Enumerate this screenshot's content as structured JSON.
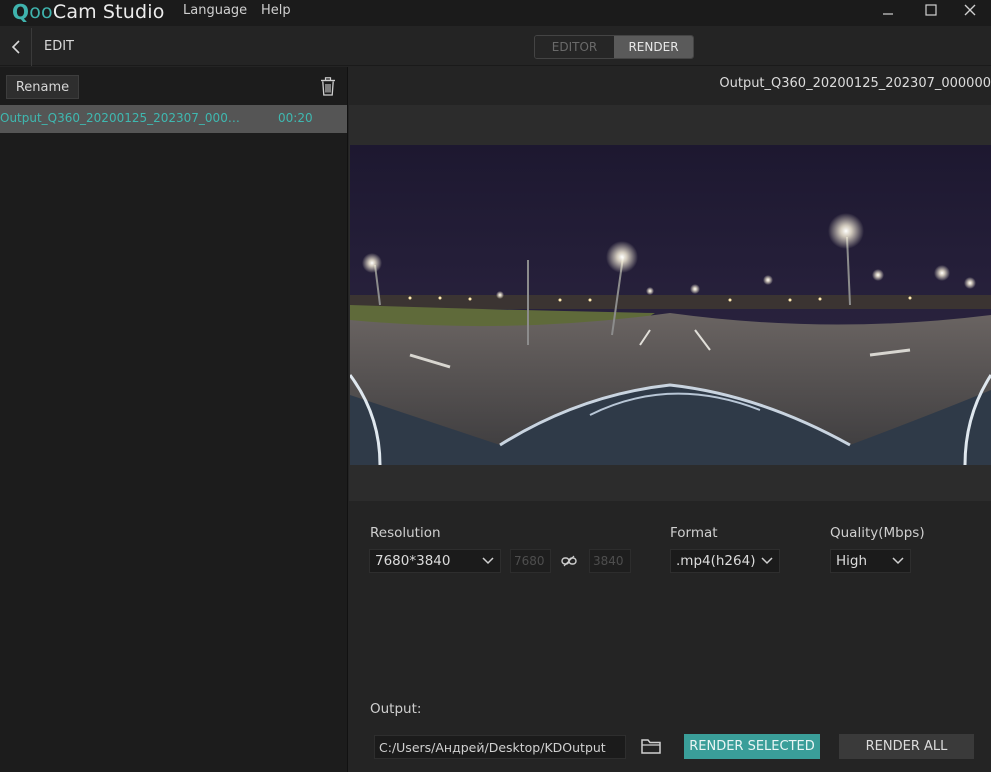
{
  "app": {
    "logo_q": "Q",
    "logo_oo": "oo",
    "logo_cam": "Cam",
    "logo_studio": "Studio"
  },
  "menu": {
    "language": "Language",
    "help": "Help"
  },
  "window": {
    "minimize_glyph": "—",
    "maximize_glyph": "☐",
    "close_glyph": "✕"
  },
  "topbar": {
    "edit_label": "EDIT",
    "modes": {
      "editor": "EDITOR",
      "render": "RENDER"
    },
    "active_mode": "RENDER"
  },
  "sidebar": {
    "rename_label": "Rename",
    "files": [
      {
        "name": "Output_Q360_20200125_202307_000…",
        "duration": "00:20"
      }
    ]
  },
  "preview": {
    "title": "Output_Q360_20200125_202307_000000"
  },
  "render_settings": {
    "resolution_label": "Resolution",
    "resolution_value": "7680*3840",
    "width_value": "7680",
    "height_value": "3840",
    "format_label": "Format",
    "format_value": ".mp4(h264)",
    "quality_label": "Quality(Mbps)",
    "quality_value": "High",
    "output_label": "Output:",
    "output_path": "C:/Users/Андрей/Desktop/KDOutput",
    "render_selected_label": "RENDER SELECTED",
    "render_all_label": "RENDER ALL"
  },
  "colors": {
    "accent": "#3fb3ad",
    "button_primary": "#3a9e99",
    "background": "#242424",
    "sidebar": "#1c1c1c",
    "selected_row": "#555555"
  }
}
